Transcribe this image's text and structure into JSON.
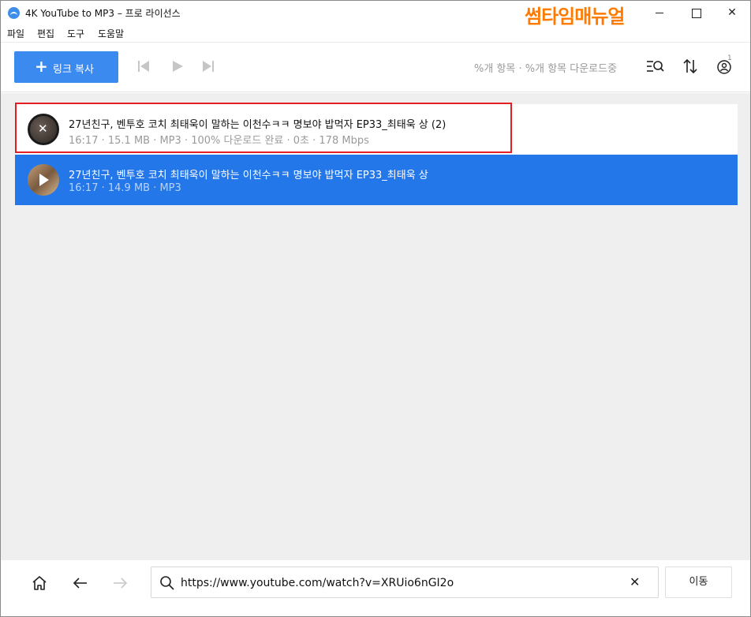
{
  "window": {
    "title": "4K YouTube to MP3 – 프로 라이선스",
    "watermark": "썸타임매뉴얼",
    "close_glyph": "✕"
  },
  "menu": {
    "items": [
      "파일",
      "편집",
      "도구",
      "도움말"
    ]
  },
  "toolbar": {
    "add_link_icon": "+",
    "add_link_label": "링크 복사",
    "status": "%개 항목 · %개 항목 다운로드중",
    "notification_count": "1"
  },
  "tracks": [
    {
      "title": "27년친구, 벤투호 코치 최태욱이 말하는 이천수ㅋㅋ   명보야 밥먹자 EP33_최태욱 상 (2)",
      "meta": "16:17 · 15.1 MB · MP3 · 100% 다운로드 완료 · 0초 · 178 Mbps",
      "thumb_overlay": "✕",
      "highlighted": true
    },
    {
      "title": "27년친구, 벤투호 코치 최태욱이 말하는 이천수ㅋㅋ   명보야 밥먹자 EP33_최태욱 상",
      "meta": "16:17 · 14.9 MB · MP3",
      "selected": true
    }
  ],
  "browser": {
    "url": "https://www.youtube.com/watch?v=XRUio6nGI2o",
    "clear_glyph": "✕",
    "go_label": "이동"
  },
  "colors": {
    "accent": "#3b8af0",
    "selected_row": "#2477e8",
    "highlight_border": "#e31e24",
    "watermark": "#ff7b00"
  }
}
